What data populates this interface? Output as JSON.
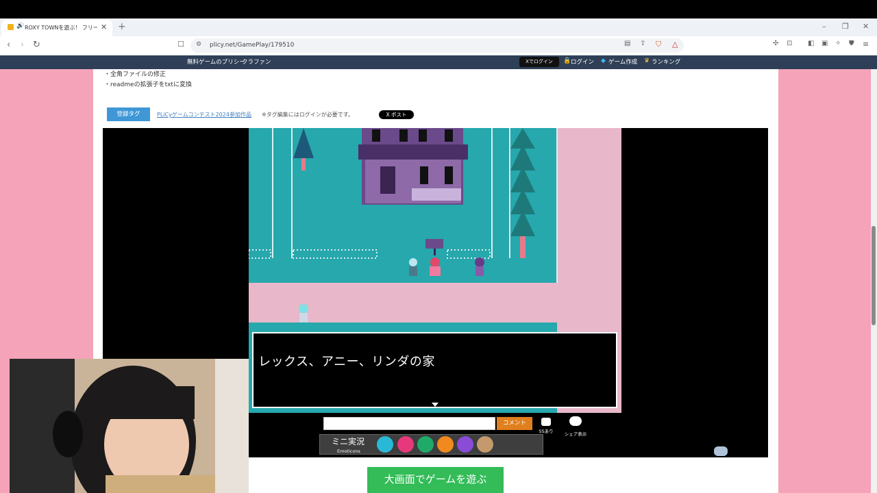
{
  "browser": {
    "tab_title": "ROXY TOWNを遊ぶ！ フリーゲ",
    "tab_sound_icon": "speaker-icon",
    "new_tab_symbol": "+",
    "url": "plicy.net/GamePlay/179510",
    "window_controls": [
      "–",
      "❐",
      "✕"
    ]
  },
  "site_nav": {
    "logo_text": "無料ゲームのプリシー",
    "crowdfund": "クラファン",
    "x_login": "Xでログイン",
    "login": "ログイン",
    "create_game": "ゲーム作成",
    "ranking": "ランキング"
  },
  "changelog": [
    "・全角ファイルの修正",
    "・readmeの拡張子をtxtに変換"
  ],
  "tags": {
    "label": "登録タグ",
    "link": "PLiCyゲームコンテスト2024参加作品",
    "note": "※タグ編集にはログインが必要です。",
    "post_button": "X ポスト"
  },
  "game": {
    "dialog_text": "レックス、アニー、リンダの家",
    "comment_placeholder": "",
    "comment_button": "コメント",
    "ss_label": "SSあり",
    "share_label": "シェア表示",
    "emoticons_title": "ミニ実況",
    "emoticons_sub": "Emoticons",
    "emoticon_colors": [
      "#29b9d6",
      "#e6397c",
      "#1faa6a",
      "#f08a1e",
      "#8a4bd6",
      "#c49a6c"
    ]
  },
  "big_play_button": "大画面でゲームを遊ぶ",
  "colors": {
    "page_background": "#f4a3b8",
    "site_nav": "#2f3f57",
    "game_teal": "#26a8ad",
    "path_pink": "#e8b7c9"
  }
}
